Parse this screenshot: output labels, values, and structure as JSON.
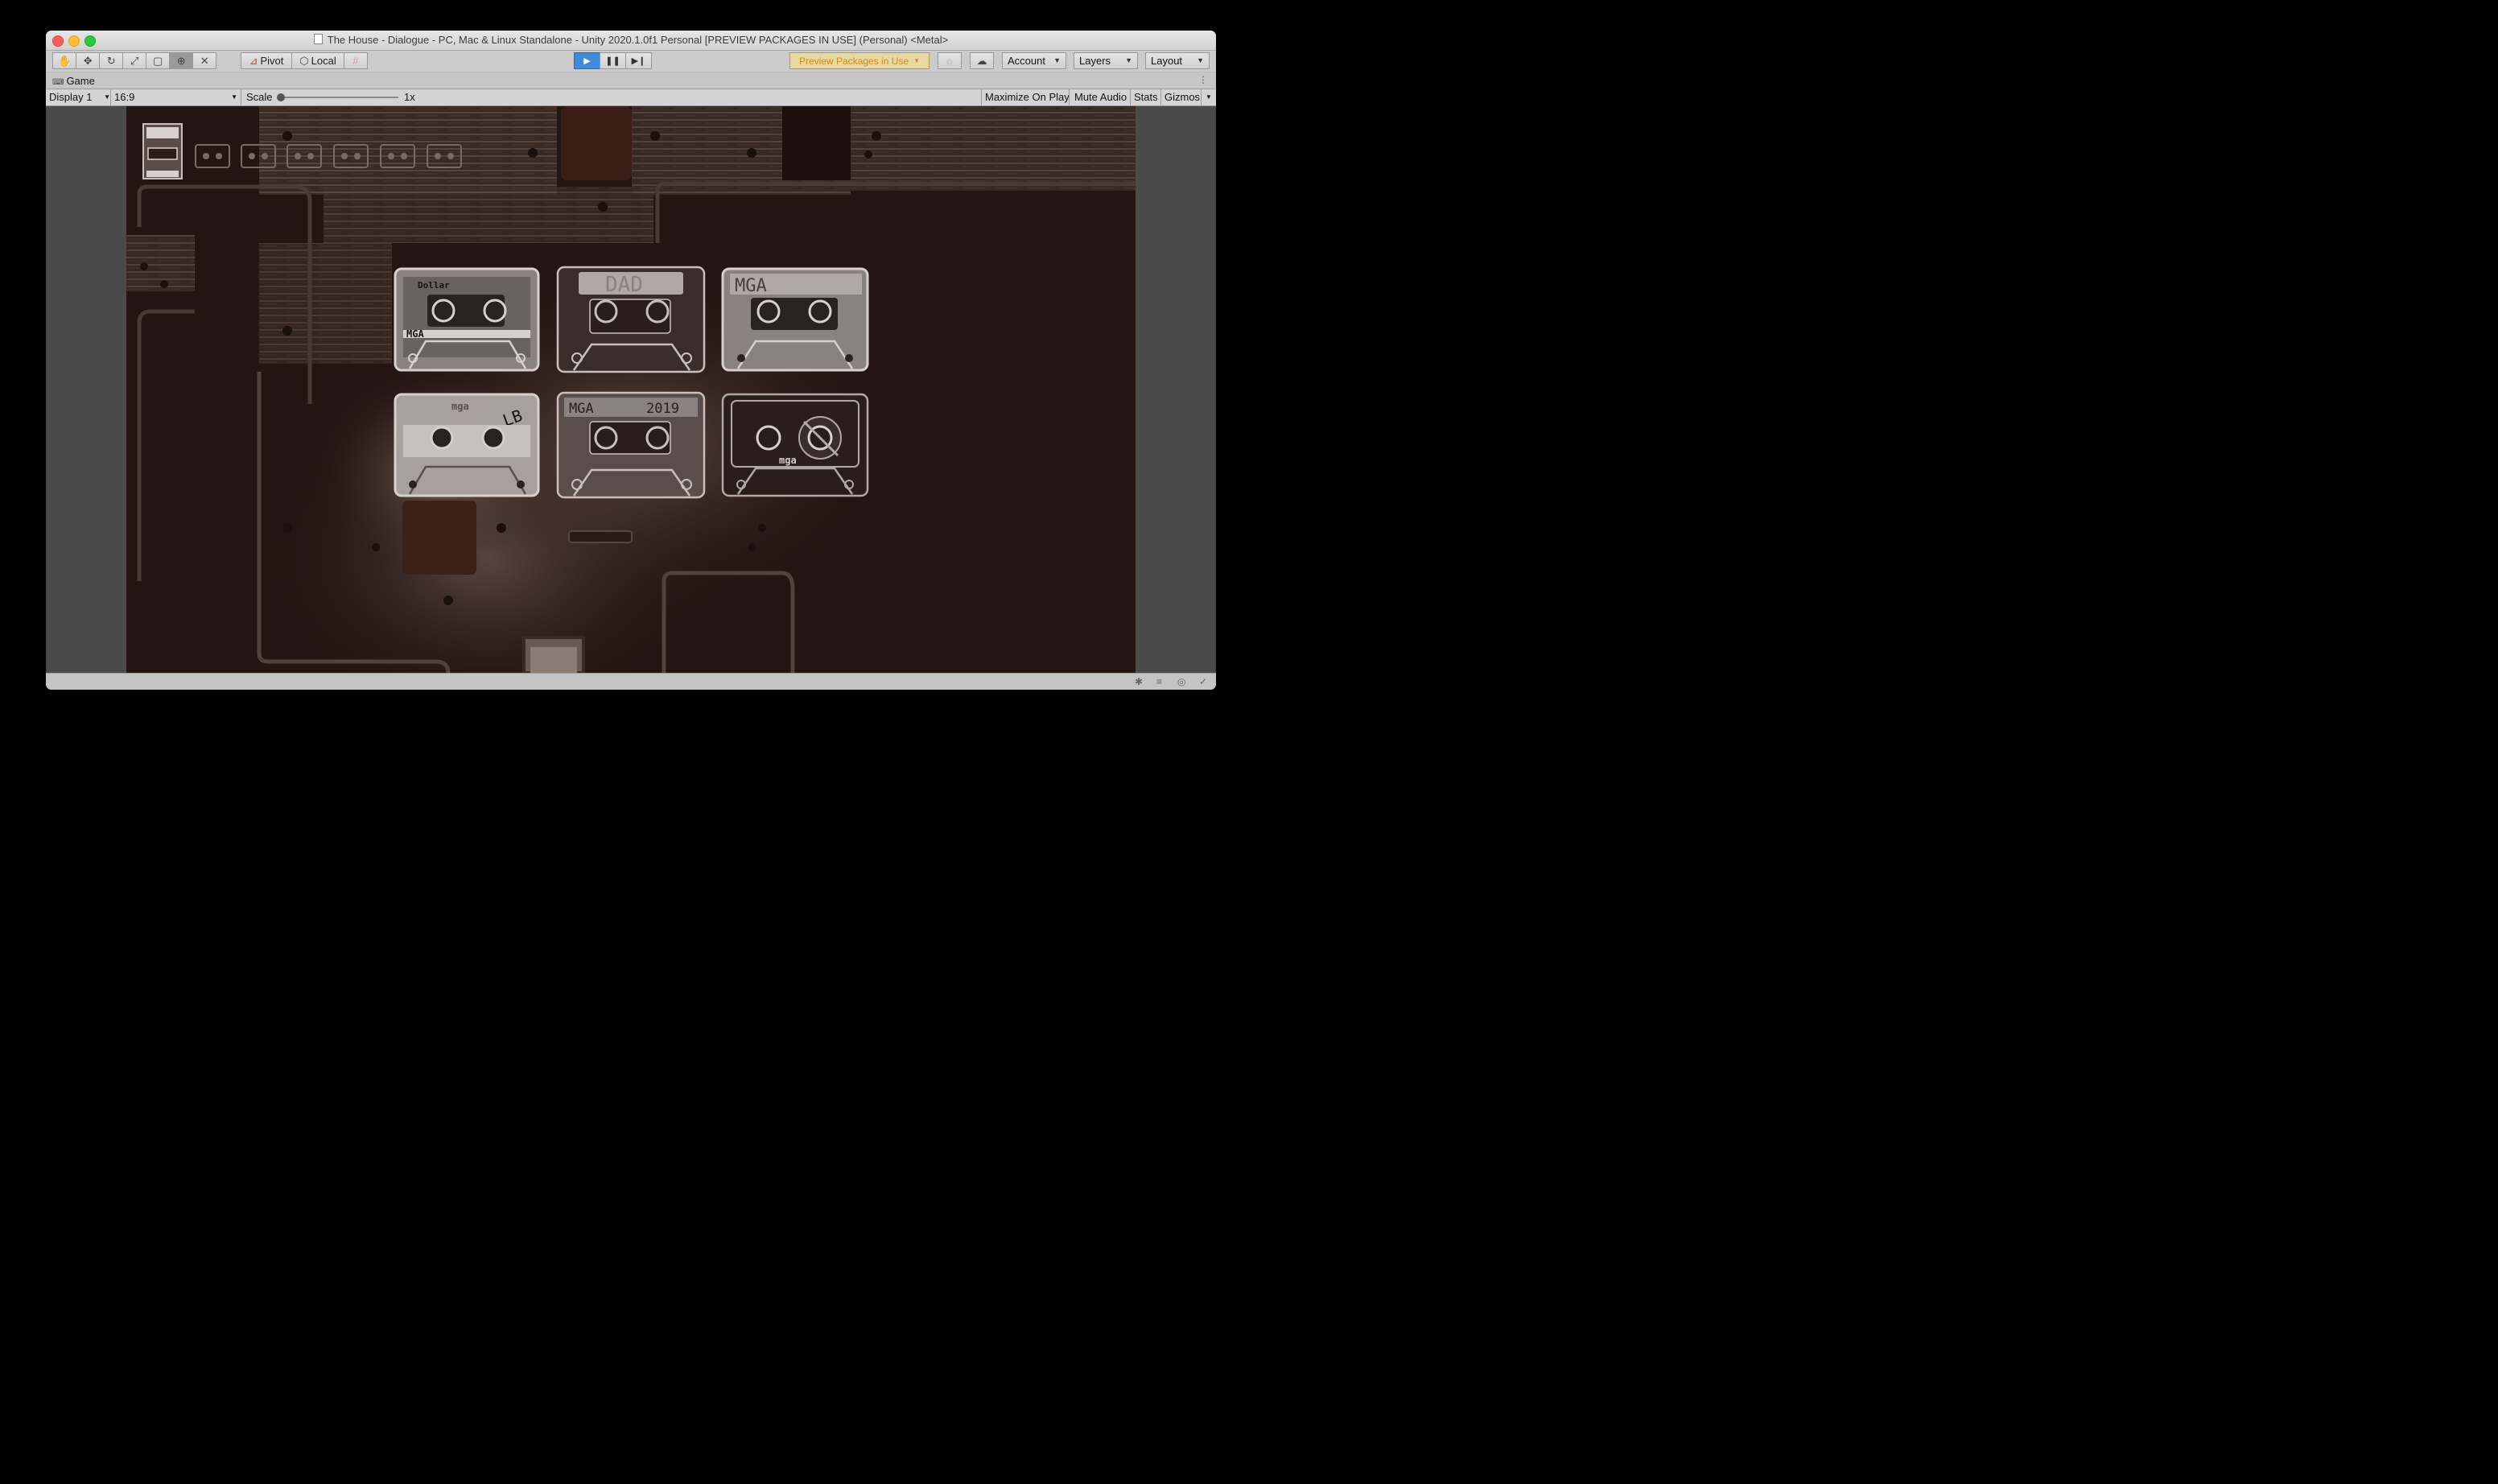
{
  "window": {
    "title": "The House - Dialogue - PC, Mac & Linux Standalone - Unity 2020.1.0f1 Personal [PREVIEW PACKAGES IN USE] (Personal) <Metal>"
  },
  "toolbar": {
    "pivot_label": "Pivot",
    "local_label": "Local",
    "preview_packages_label": "Preview Packages in Use",
    "account_label": "Account",
    "layers_label": "Layers",
    "layout_label": "Layout"
  },
  "tab": {
    "label": "Game"
  },
  "gamebar": {
    "display_value": "Display 1",
    "aspect_value": "16:9",
    "scale_label": "Scale",
    "scale_value": "1x",
    "maximize_label": "Maximize On Play",
    "mute_label": "Mute Audio",
    "stats_label": "Stats",
    "gizmos_label": "Gizmos"
  },
  "game": {
    "tapes": [
      {
        "label": "MGA",
        "note": "Dollar"
      },
      {
        "label": "DAD"
      },
      {
        "label": "MGA"
      },
      {
        "label": "mga",
        "note": "LB"
      },
      {
        "label": "MGA",
        "note": "2019"
      },
      {
        "label": "mga"
      }
    ]
  }
}
